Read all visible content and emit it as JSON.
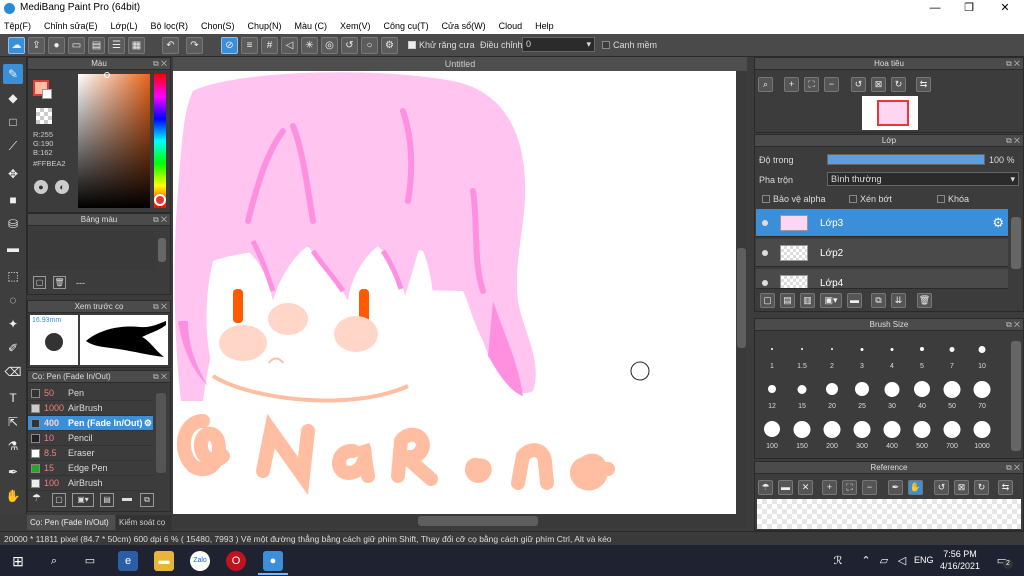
{
  "window": {
    "title": "MediBang Paint Pro (64bit)",
    "minimize": "—",
    "maximize": "❐",
    "close": "✕"
  },
  "menu": [
    "Tệp(F)",
    "Chỉnh sửa(E)",
    "Lớp(L)",
    "Bộ lọc(R)",
    "Chọn(S)",
    "Chụp(N)",
    "Màu (C)",
    "Xem(V)",
    "Công cụ(T)",
    "Cửa sổ(W)",
    "Cloud",
    "Help"
  ],
  "toolbar": {
    "antialias_label": "Khử răng cưa",
    "adjust_label": "Điều chỉnh",
    "adjust_value": "0",
    "snap_label": "Canh mềm"
  },
  "panels": {
    "color": {
      "title": "Màu",
      "r": "R:255",
      "g": "G:190",
      "b": "B:162",
      "hex": "#FFBEA2",
      "main_color": "#FFBEA2"
    },
    "palette": {
      "title": "Bảng màu",
      "footer": "---"
    },
    "brush_preview": {
      "title": "Xem trước cọ",
      "size": "16.93mm"
    },
    "brush_list": {
      "title": "Cọ: Pen (Fade In/Out)",
      "items": [
        {
          "size": "50",
          "name": "Pen",
          "swatch": "#333333"
        },
        {
          "size": "1000",
          "name": "AirBrush",
          "swatch": "#cccccc"
        },
        {
          "size": "400",
          "name": "Pen (Fade In/Out)",
          "swatch": "#333333"
        },
        {
          "size": "10",
          "name": "Pencil",
          "swatch": "#222222"
        },
        {
          "size": "8.5",
          "name": "Eraser",
          "swatch": "#ffffff"
        },
        {
          "size": "15",
          "name": "Edge Pen",
          "swatch": "#22aa22"
        },
        {
          "size": "100",
          "name": "AirBrush",
          "swatch": "#eeeeee"
        }
      ]
    },
    "bottom_tabs": [
      "Cọ: Pen (Fade In/Out)",
      "Kiểm soát cọ"
    ]
  },
  "canvas": {
    "tab_title": "Untitled",
    "signature": "@NaRone"
  },
  "navigator": {
    "title": "Hoa tiêu"
  },
  "layers": {
    "title": "Lớp",
    "opacity_label": "Độ trong",
    "opacity_value": "100 %",
    "opacity": 100,
    "blend_label": "Pha trộn",
    "blend_value": "Bình thường",
    "protect_alpha": "Bảo vệ alpha",
    "clipping": "Xén bớt",
    "lock": "Khóa",
    "items": [
      {
        "name": "Lớp3",
        "selected": true
      },
      {
        "name": "Lớp2",
        "selected": false
      },
      {
        "name": "Lớp4",
        "selected": false
      }
    ]
  },
  "brush_size": {
    "title": "Brush Size",
    "sizes": [
      "1",
      "1.5",
      "2",
      "3",
      "4",
      "5",
      "7",
      "10",
      "12",
      "15",
      "20",
      "25",
      "30",
      "40",
      "50",
      "70",
      "100",
      "150",
      "200",
      "300",
      "400",
      "500",
      "700",
      "1000"
    ]
  },
  "reference": {
    "title": "Reference"
  },
  "status": {
    "text": "20000 * 11811 pixel  (84.7 * 50cm)  600 dpi  6 %  ( 15480, 7993 )  Vẽ một đường thẳng bằng cách giữ phím Shift, Thay đổi cỡ cọ bằng cách giữ phím Ctrl, Alt và kéo"
  },
  "taskbar": {
    "lang": "ENG",
    "time": "7:56 PM",
    "date": "4/16/2021",
    "notifications": "2"
  }
}
